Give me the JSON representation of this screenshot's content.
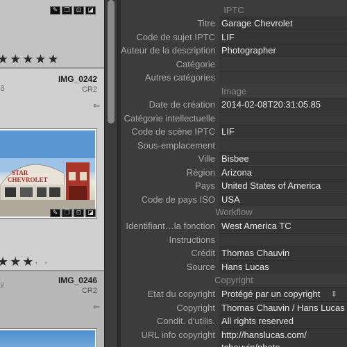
{
  "grid": {
    "cells": [
      {
        "index": "",
        "filename": "",
        "filetype": "",
        "rating": 5
      },
      {
        "index": "8",
        "filename": "IMG_0242",
        "filetype": "CR2",
        "rating": 3
      },
      {
        "index": "",
        "filename": "IMG_0246",
        "filetype": "CR2",
        "rating": 0
      }
    ],
    "sign_text": "STAR\nCHEVROLET"
  },
  "metadata": {
    "sections": {
      "iptc": "IPTC",
      "image": "Image",
      "workflow": "Workflow",
      "copyright": "Copyright"
    },
    "fields": [
      {
        "label": "Titre",
        "value": "Garage Chevrolet"
      },
      {
        "label": "Code de sujet IPTC",
        "value": "LIF"
      },
      {
        "label": "Auteur de la description",
        "value": "Photographer"
      },
      {
        "label": "Catégorie",
        "value": ""
      },
      {
        "label": "Autres catégories",
        "value": ""
      },
      {
        "label": "Date de création",
        "value": "2014-02-08T20:31:05.85"
      },
      {
        "label": "Catégorie intellectuelle",
        "value": ""
      },
      {
        "label": "Code de scène IPTC",
        "value": "LIF"
      },
      {
        "label": "Sous-emplacement",
        "value": ""
      },
      {
        "label": "Ville",
        "value": "Bisbee"
      },
      {
        "label": "Région",
        "value": "Arizona"
      },
      {
        "label": "Pays",
        "value": "United States of America"
      },
      {
        "label": "Code de pays ISO",
        "value": "USA"
      },
      {
        "label": "Identifiant…la fonction",
        "value": "West America TC"
      },
      {
        "label": "Instructions",
        "value": ""
      },
      {
        "label": "Crédit",
        "value": "Thomas Chauvin"
      },
      {
        "label": "Source",
        "value": "Hans Lucas"
      },
      {
        "label": "Etat du copyright",
        "value": "Protégé par un copyright"
      },
      {
        "label": "Copyright",
        "value": "Thomas Chauvin / Hans Lucas"
      },
      {
        "label": "Condit. d'utilis.",
        "value": "All rights reserved"
      },
      {
        "label": "URL info copyright",
        "value": "http://hanslucas.com/\ntchauvin/photo"
      }
    ]
  }
}
